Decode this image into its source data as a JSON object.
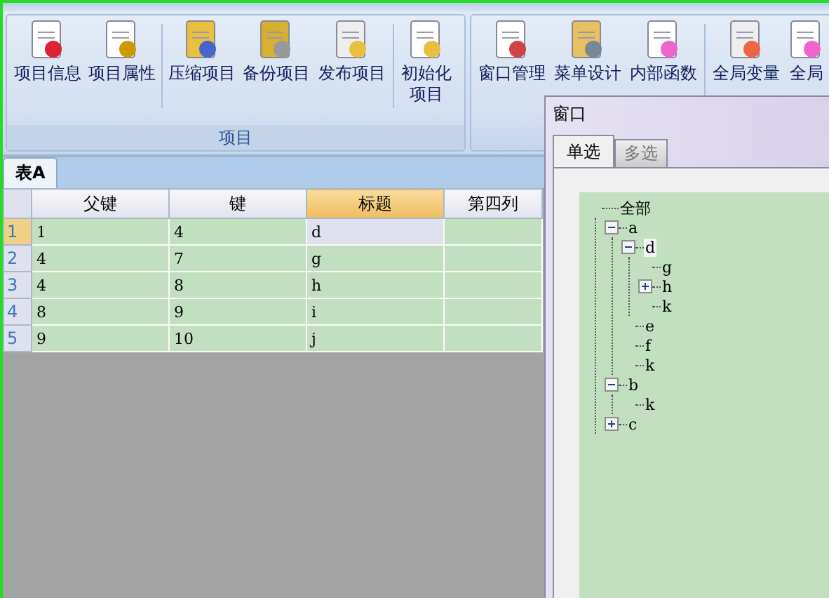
{
  "ribbon": {
    "groups": [
      {
        "label": "项目",
        "sections": [
          [
            "项目信息",
            "项目属性"
          ],
          [
            "压缩项目",
            "备份项目",
            "发布项目"
          ],
          [
            "初始化项目"
          ]
        ]
      },
      {
        "sections": [
          [
            "窗口管理",
            "菜单设计",
            "内部函数"
          ],
          [
            "全局变量",
            "全局"
          ]
        ]
      }
    ]
  },
  "sheet_tabs": [
    {
      "label": "表A",
      "selected": true
    }
  ],
  "table": {
    "columns": [
      {
        "label": "父键",
        "selected": false
      },
      {
        "label": "键",
        "selected": false
      },
      {
        "label": "标题",
        "selected": true
      },
      {
        "label": "第四列",
        "selected": false
      }
    ],
    "rows": [
      {
        "header": "1",
        "selected": true,
        "cells": [
          "1",
          "4",
          "d",
          ""
        ]
      },
      {
        "header": "2",
        "selected": false,
        "cells": [
          "4",
          "7",
          "g",
          ""
        ]
      },
      {
        "header": "3",
        "selected": false,
        "cells": [
          "4",
          "8",
          "h",
          ""
        ]
      },
      {
        "header": "4",
        "selected": false,
        "cells": [
          "8",
          "9",
          "i",
          ""
        ]
      },
      {
        "header": "5",
        "selected": false,
        "cells": [
          "9",
          "10",
          "j",
          ""
        ]
      }
    ]
  },
  "window": {
    "title": "窗口",
    "tabs": [
      {
        "label": "单选",
        "selected": true
      },
      {
        "label": "多选",
        "selected": false
      }
    ],
    "tree": [
      {
        "label": "全部",
        "selected": false,
        "children": [
          {
            "label": "a",
            "expanded": true,
            "selected": false,
            "children": [
              {
                "label": "d",
                "expanded": true,
                "selected": true,
                "children": [
                  {
                    "label": "g",
                    "selected": false
                  },
                  {
                    "label": "h",
                    "expanded": false,
                    "selected": false
                  },
                  {
                    "label": "k",
                    "selected": false
                  }
                ]
              },
              {
                "label": "e",
                "selected": false
              },
              {
                "label": "f",
                "selected": false
              },
              {
                "label": "k",
                "selected": false
              }
            ]
          },
          {
            "label": "b",
            "expanded": true,
            "selected": false,
            "children": [
              {
                "label": "k",
                "selected": false
              }
            ]
          },
          {
            "label": "c",
            "expanded": false,
            "selected": false
          }
        ]
      }
    ]
  }
}
